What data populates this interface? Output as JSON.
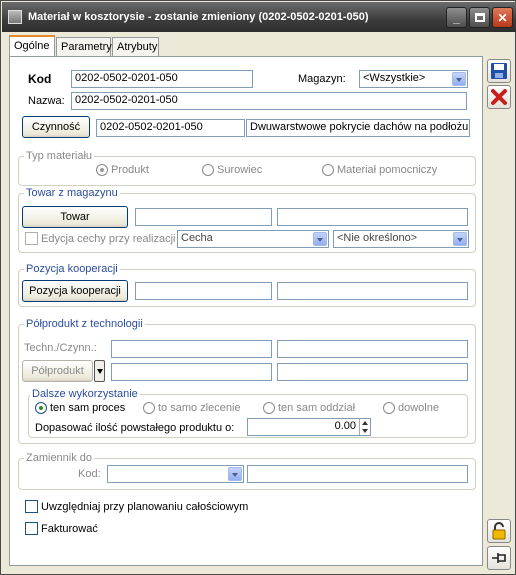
{
  "window": {
    "title": "Materiał w kosztorysie - zostanie zmieniony  (0202-0502-0201-050)"
  },
  "tabs": [
    "Ogólne",
    "Parametry",
    "Atrybuty"
  ],
  "header": {
    "kod_label": "Kod",
    "kod_value": "0202-0502-0201-050",
    "magazyn_label": "Magazyn:",
    "magazyn_value": "<Wszystkie>",
    "nazwa_label": "Nazwa:",
    "nazwa_value": "0202-0502-0201-050",
    "czynnosc_button": "Czynność",
    "czynnosc_code": "0202-0502-0201-050",
    "czynnosc_name": "Dwuwarstwowe pokrycie dachów na podłożu"
  },
  "typ_materialu": {
    "label": "Typ materiału",
    "options": [
      "Produkt",
      "Surowiec",
      "Materiał pomocniczy"
    ],
    "selected": "Produkt"
  },
  "towar_z_magazynu": {
    "label": "Towar z magazynu",
    "button": "Towar",
    "field1": "",
    "field2": "",
    "edycja_label": "Edycja cechy przy realizacji",
    "cecha_value": "Cecha",
    "nie_okreslono_value": "<Nie określono>"
  },
  "pozycja_kooperacji": {
    "label": "Pozycja kooperacji",
    "button": "Pozycja kooperacji",
    "field1": "",
    "field2": ""
  },
  "polprodukt": {
    "label": "Półprodukt z technologii",
    "techn_label": "Techn./Czynn.:",
    "button": "Półprodukt",
    "dalsze": {
      "label": "Dalsze wykorzystanie",
      "options": [
        "ten sam proces",
        "to samo zlecenie",
        "ten sam oddział",
        "dowolne"
      ],
      "selected": "ten sam proces"
    },
    "dopasowac_label": "Dopasować ilość powstałego produktu o:",
    "dopasowac_value": "0.00"
  },
  "zamiennik": {
    "label": "Zamiennik do",
    "kod_label": "Kod:",
    "kod_value": "",
    "field": ""
  },
  "checkboxes": {
    "planowanie_label": "Uwzględniaj przy planowaniu całościowym",
    "fakturowac_label": "Fakturować"
  },
  "colors": {
    "titlebar": "#3c3c3c",
    "group_title": "#2c4d9a",
    "tab_accent": "#e68b2c"
  }
}
